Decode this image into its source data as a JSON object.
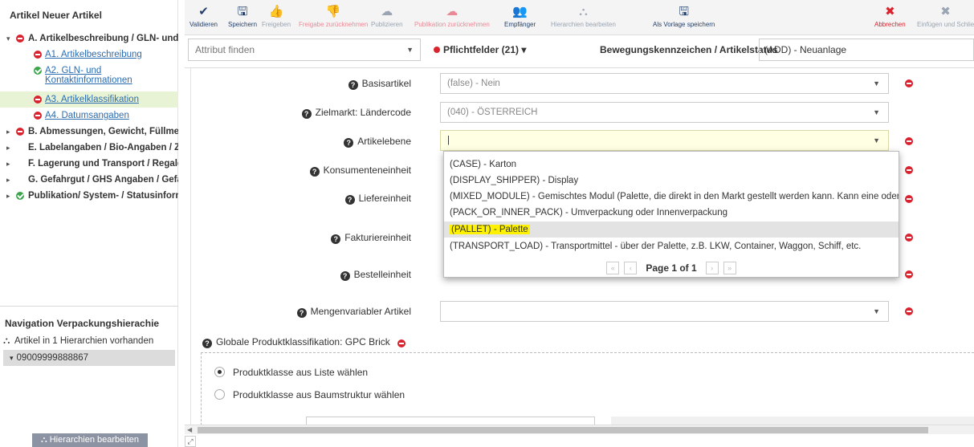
{
  "sidebar": {
    "title": "Artikel Neuer Artikel",
    "tree": [
      {
        "label": "A. Artikelbeschreibung / GLN- und K",
        "status": "red",
        "caret": "▾"
      },
      {
        "label": "A1. Artikelbeschreibung",
        "status": "red"
      },
      {
        "label_line1": "A2. GLN- und",
        "label_line2": "Kontaktinformationen",
        "status": "green"
      },
      {
        "label": "A3. Artikelklassifikation",
        "status": "red"
      },
      {
        "label": "A4. Datumsangaben",
        "status": "red"
      },
      {
        "label": "B. Abmessungen, Gewicht, Füllmeng",
        "status": "red",
        "caret": "▸"
      },
      {
        "label": "E. Labelangaben / Bio-Angaben / Zie",
        "caret": "▸"
      },
      {
        "label": "F. Lagerung und Transport / Regaleir",
        "caret": "▸"
      },
      {
        "label": "G. Gefahrgut / GHS Angaben / Gefah",
        "caret": "▸"
      },
      {
        "label": "Publikation/ System- / Statusinforma",
        "status": "green",
        "caret": "▸"
      }
    ],
    "nav_title": "Navigation Verpackungshierachie",
    "nav_hier_text": "Artikel in 1 Hierarchien vorhanden",
    "nav_item": "09009999888867",
    "hier_button": "Hierarchien bearbeiten"
  },
  "toolbar": {
    "validieren": "Validieren",
    "speichern": "Speichern",
    "freigeben": "Freigeben",
    "freigabe_zurueck": "Freigabe zurücknehmen",
    "publizieren": "Publizieren",
    "publikation_zurueck": "Publikation zurücknehmen",
    "empfaenger": "Empfänger",
    "hierarchien": "Hierarchien bearbeiten",
    "als_vorlage": "Als Vorlage speichern",
    "abbrechen": "Abbrechen",
    "einfuegen": "Einfügen und Schlie"
  },
  "filter": {
    "attr_placeholder": "Attribut finden",
    "pflicht": "Pflichtfelder (21) ▾",
    "bew_label": "Bewegungskennzeichen / Artikelstatus",
    "bew_value": "(ADD) - Neuanlage"
  },
  "form": {
    "basisartikel_label": "Basisartikel",
    "basisartikel_value": "(false) - Nein",
    "zielmarkt_label": "Zielmarkt: Ländercode",
    "zielmarkt_value": "(040) - ÖSTERREICH",
    "artikelebene_label": "Artikelebene",
    "artikelebene_value": "|",
    "konsument_label": "Konsumenteneinheit",
    "liefer_label": "Liefereinheit",
    "faktur_label": "Fakturiereinheit",
    "bestell_label": "Bestelleinheit",
    "mengen_label": "Mengenvariabler Artikel",
    "gpc_label": "Globale Produktklassifikation: GPC Brick",
    "radio_liste": "Produktklasse aus Liste wählen",
    "radio_baum": "Produktklasse aus Baumstruktur wählen"
  },
  "dropdown": {
    "options": [
      "(CASE) - Karton",
      "(DISPLAY_SHIPPER) - Display",
      "(MIXED_MODULE) - Gemischtes Modul (Palette, die direkt in den Markt gestellt werden kann. Kann eine oder auch…",
      "(PACK_OR_INNER_PACK) - Umverpackung oder Innenverpackung",
      "(PALLET) - Palette",
      "(TRANSPORT_LOAD) - Transportmittel - über der Palette, z.B. LKW, Container, Waggon, Schiff, etc."
    ],
    "highlighted_index": 4,
    "page_text": "Page 1 of 1"
  },
  "colors": {
    "accent_red": "#d9232e",
    "accent_green": "#3aa54a",
    "toolbar_dark": "#24406b",
    "highlight_yellow": "#fff200"
  }
}
